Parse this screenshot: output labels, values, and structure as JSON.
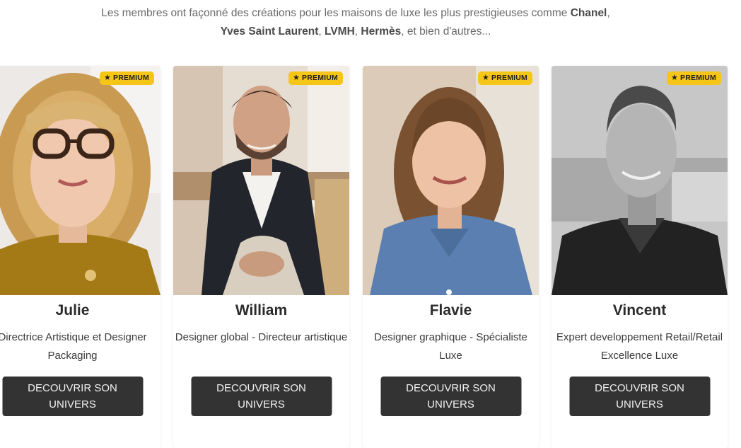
{
  "intro": {
    "line1_prefix": "Les membres ont façonné des créations pour les maisons de luxe les plus prestigieuses comme ",
    "brand1": "Chanel",
    "line1_suffix": ",",
    "brand2": "Yves Saint Laurent",
    "sep1": ", ",
    "brand3": "LVMH",
    "sep2": ", ",
    "brand4": "Hermès",
    "line2_suffix": ", et bien d'autres..."
  },
  "badge_icon": "star-icon",
  "colors": {
    "badge": "#f5c518",
    "button": "#333333",
    "button_text": "#f2f2f2"
  },
  "members": [
    {
      "name": "Julie",
      "role": "Directrice Artistique et Designer Packaging",
      "badge": "PREMIUM",
      "cta": "DECOUVRIR SON UNIVERS"
    },
    {
      "name": "William",
      "role": "Designer global - Directeur artistique",
      "badge": "PREMIUM",
      "cta": "DECOUVRIR SON UNIVERS"
    },
    {
      "name": "Flavie",
      "role": "Designer graphique - Spécialiste Luxe",
      "badge": "PREMIUM",
      "cta": "DECOUVRIR SON UNIVERS"
    },
    {
      "name": "Vincent",
      "role": "Expert developpement Retail/Retail Excellence Luxe",
      "badge": "PREMIUM",
      "cta": "DECOUVRIR SON UNIVERS"
    }
  ]
}
